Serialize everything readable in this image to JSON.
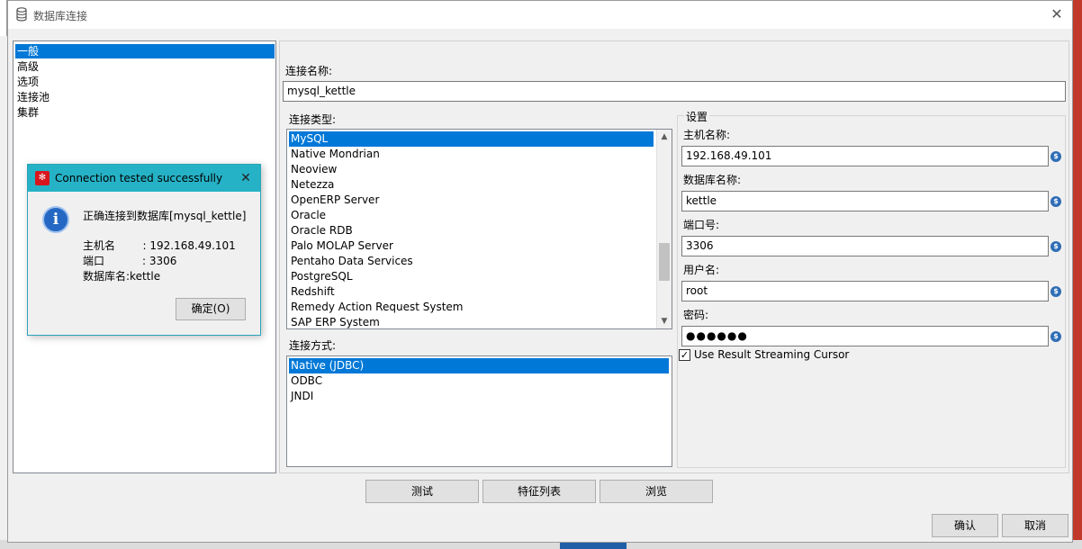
{
  "window": {
    "title": "数据库连接",
    "close_glyph": "✕"
  },
  "nav": {
    "items": [
      "一般",
      "高级",
      "选项",
      "连接池",
      "集群"
    ],
    "selected_index": 0
  },
  "connection_name": {
    "label": "连接名称:",
    "value": "mysql_kettle"
  },
  "connection_type": {
    "label": "连接类型:",
    "items": [
      "MySQL",
      "Native Mondrian",
      "Neoview",
      "Netezza",
      "OpenERP Server",
      "Oracle",
      "Oracle RDB",
      "Palo MOLAP Server",
      "Pentaho Data Services",
      "PostgreSQL",
      "Redshift",
      "Remedy Action Request System",
      "SAP ERP System"
    ],
    "selected": "MySQL"
  },
  "access_method": {
    "label": "连接方式:",
    "items": [
      "Native (JDBC)",
      "ODBC",
      "JNDI"
    ],
    "selected": "Native (JDBC)"
  },
  "settings": {
    "title": "设置",
    "host_label": "主机名称:",
    "host_value": "192.168.49.101",
    "db_label": "数据库名称:",
    "db_value": "kettle",
    "port_label": "端口号:",
    "port_value": "3306",
    "user_label": "用户名:",
    "user_value": "root",
    "password_label": "密码:",
    "password_value": "●●●●●●",
    "variable_icon": "$",
    "streaming_checkbox": {
      "label": "Use Result Streaming Cursor",
      "checked": true,
      "glyph": "✓"
    }
  },
  "buttons": {
    "test": "测试",
    "features": "特征列表",
    "explore": "浏览",
    "ok": "确认",
    "cancel": "取消"
  },
  "dialog": {
    "title": "Connection tested successfully",
    "close_glyph": "✕",
    "logo_glyph": "✻",
    "info_glyph": "i",
    "message": "正确连接到数据库[mysql_kettle]",
    "host_line": "主机名        : 192.168.49.101",
    "port_line": "端口           : 3306",
    "db_line": "数据库名:kettle",
    "ok_button": "确定(O)"
  },
  "icons": {
    "window": "database-icon",
    "dialog_logo": "pentaho-logo-icon",
    "info": "info-icon",
    "scroll_up": "▲",
    "scroll_down": "▼"
  },
  "colors": {
    "selection": "#0078d7",
    "dialog_title": "#26b2c6",
    "variable_icon": "#2f6db5"
  }
}
